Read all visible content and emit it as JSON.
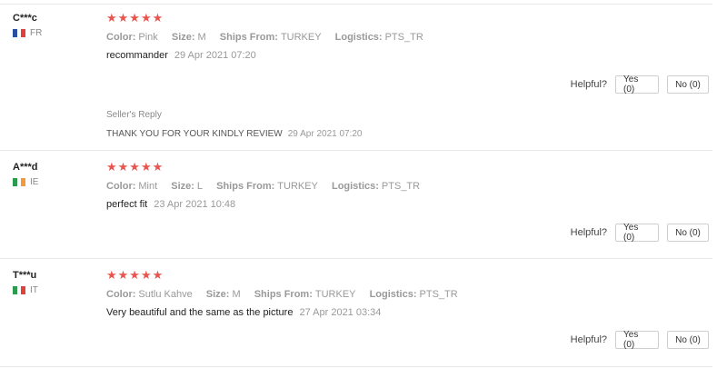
{
  "labels": {
    "color": "Color:",
    "size": "Size:",
    "ships_from": "Ships From:",
    "logistics": "Logistics:",
    "helpful": "Helpful?",
    "yes": "Yes (0)",
    "no": "No (0)",
    "stars": "★★★★★"
  },
  "reviews": [
    {
      "user": "C***c",
      "country": "FR",
      "flag_colors": [
        "#2b4ea0",
        "#ffffff",
        "#e0413b"
      ],
      "rating": 5,
      "color": "Pink",
      "size": "M",
      "ships_from": "TURKEY",
      "logistics": "PTS_TR",
      "text": "recommander",
      "date": "29 Apr 2021 07:20",
      "seller_reply": {
        "title": "Seller's Reply",
        "text": "THANK YOU FOR YOUR KINDLY REVIEW",
        "date": "29 Apr 2021 07:20"
      }
    },
    {
      "user": "A***d",
      "country": "IE",
      "flag_colors": [
        "#2e9a4e",
        "#ffffff",
        "#f39b3a"
      ],
      "rating": 5,
      "color": "Mint",
      "size": "L",
      "ships_from": "TURKEY",
      "logistics": "PTS_TR",
      "text": "perfect fit",
      "date": "23 Apr 2021 10:48"
    },
    {
      "user": "T***u",
      "country": "IT",
      "flag_colors": [
        "#2e9a4e",
        "#ffffff",
        "#e0413b"
      ],
      "rating": 5,
      "color": "Sutlu Kahve",
      "size": "M",
      "ships_from": "TURKEY",
      "logistics": "PTS_TR",
      "text": "Very beautiful and the same as the picture",
      "date": "27 Apr 2021 03:34"
    }
  ]
}
